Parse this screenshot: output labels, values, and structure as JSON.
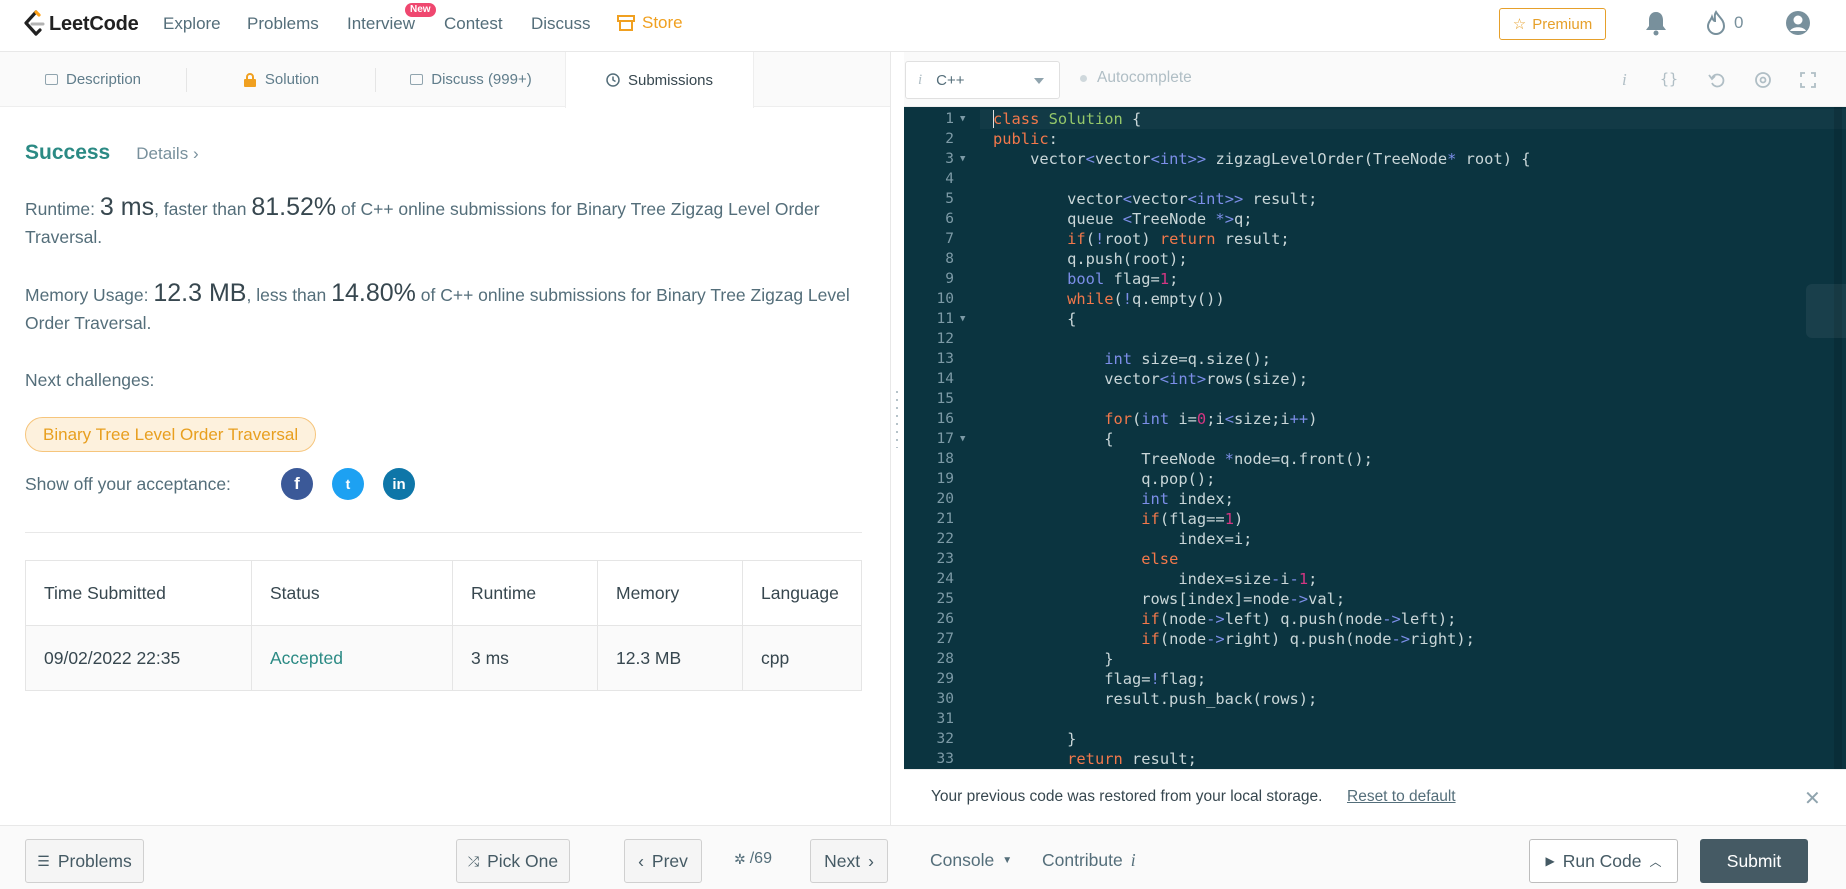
{
  "nav": {
    "logo_text": "LeetCode",
    "links": [
      "Explore",
      "Problems",
      "Interview",
      "Contest",
      "Discuss"
    ],
    "new_badge": "New",
    "store": "Store",
    "premium": "Premium",
    "streak_count": "0",
    "brand_color": "#f0a020"
  },
  "tabs": {
    "description": "Description",
    "solution": "Solution",
    "discuss": "Discuss (999+)",
    "submissions": "Submissions"
  },
  "result": {
    "status": "Success",
    "details": "Details",
    "runtime_label": "Runtime: ",
    "runtime_value": "3 ms",
    "runtime_mid": ", faster than ",
    "runtime_pct": "81.52%",
    "runtime_tail": " of C++ online submissions for Binary Tree Zigzag Level Order Traversal.",
    "memory_label": "Memory Usage: ",
    "memory_value": "12.3 MB",
    "memory_mid": ", less than ",
    "memory_pct": "14.80%",
    "memory_tail": " of C++ online submissions for Binary Tree Zigzag Level Order Traversal.",
    "next_challenges": "Next challenges:",
    "challenge": "Binary Tree Level Order Traversal",
    "show_off": "Show off your acceptance:",
    "social": [
      "f",
      "t",
      "in"
    ]
  },
  "table": {
    "headers": [
      "Time Submitted",
      "Status",
      "Runtime",
      "Memory",
      "Language"
    ],
    "rows": [
      [
        "09/02/2022 22:35",
        "Accepted",
        "3 ms",
        "12.3 MB",
        "cpp"
      ]
    ]
  },
  "editor": {
    "language": "C++",
    "autocomplete": "Autocomplete",
    "lines": [
      [
        [
          "kw",
          "class"
        ],
        [
          "",
          " "
        ],
        [
          "cls",
          "Solution"
        ],
        [
          "",
          " {"
        ]
      ],
      [
        [
          "kw",
          "public"
        ],
        [
          "",
          ":"
        ]
      ],
      [
        [
          "",
          "    vector"
        ],
        [
          "ty",
          "<"
        ],
        [
          "",
          "vector"
        ],
        [
          "ty",
          "<int>>"
        ],
        [
          "",
          " zigzagLevelOrder(TreeNode"
        ],
        [
          "ty",
          "*"
        ],
        [
          "",
          " root) {"
        ]
      ],
      [
        [
          "",
          ""
        ]
      ],
      [
        [
          "",
          "        vector"
        ],
        [
          "ty",
          "<"
        ],
        [
          "",
          "vector"
        ],
        [
          "ty",
          "<int>>"
        ],
        [
          "",
          " result;"
        ]
      ],
      [
        [
          "",
          "        queue "
        ],
        [
          "ty",
          "<"
        ],
        [
          "",
          "TreeNode "
        ],
        [
          "ty",
          "*>"
        ],
        [
          "",
          "q;"
        ]
      ],
      [
        [
          "",
          "        "
        ],
        [
          "kw",
          "if"
        ],
        [
          "",
          "("
        ],
        [
          "ty",
          "!"
        ],
        [
          "",
          "root) "
        ],
        [
          "kw",
          "return"
        ],
        [
          "",
          " result;"
        ]
      ],
      [
        [
          "",
          "        q.push(root);"
        ]
      ],
      [
        [
          "",
          "        "
        ],
        [
          "ty",
          "bool"
        ],
        [
          "",
          " flag="
        ],
        [
          "nm",
          "1"
        ],
        [
          "",
          ";"
        ]
      ],
      [
        [
          "",
          "        "
        ],
        [
          "kw",
          "while"
        ],
        [
          "",
          "("
        ],
        [
          "ty",
          "!"
        ],
        [
          "",
          "q.empty())"
        ]
      ],
      [
        [
          "",
          "        {"
        ]
      ],
      [
        [
          "",
          ""
        ]
      ],
      [
        [
          "",
          "            "
        ],
        [
          "ty",
          "int"
        ],
        [
          "",
          " size=q.size();"
        ]
      ],
      [
        [
          "",
          "            vector"
        ],
        [
          "ty",
          "<int>"
        ],
        [
          "",
          "rows(size);"
        ]
      ],
      [
        [
          "",
          ""
        ]
      ],
      [
        [
          "",
          "            "
        ],
        [
          "kw",
          "for"
        ],
        [
          "",
          "("
        ],
        [
          "ty",
          "int"
        ],
        [
          "",
          " i="
        ],
        [
          "nm",
          "0"
        ],
        [
          "",
          ";i"
        ],
        [
          "ty",
          "<"
        ],
        [
          "",
          "size;i"
        ],
        [
          "ty",
          "++"
        ],
        [
          "",
          ")"
        ]
      ],
      [
        [
          "",
          "            {"
        ]
      ],
      [
        [
          "",
          "                TreeNode "
        ],
        [
          "ty",
          "*"
        ],
        [
          "",
          "node=q.front();"
        ]
      ],
      [
        [
          "",
          "                q.pop();"
        ]
      ],
      [
        [
          "",
          "                "
        ],
        [
          "ty",
          "int"
        ],
        [
          "",
          " index;"
        ]
      ],
      [
        [
          "",
          "                "
        ],
        [
          "kw",
          "if"
        ],
        [
          "",
          "(flag=="
        ],
        [
          "nm",
          "1"
        ],
        [
          "",
          ")"
        ]
      ],
      [
        [
          "",
          "                    index=i;"
        ]
      ],
      [
        [
          "",
          "                "
        ],
        [
          "kw",
          "else"
        ]
      ],
      [
        [
          "",
          "                    index=size"
        ],
        [
          "ty",
          "-"
        ],
        [
          "",
          "i"
        ],
        [
          "ty",
          "-"
        ],
        [
          "nm",
          "1"
        ],
        [
          "",
          ";"
        ]
      ],
      [
        [
          "",
          "                rows[index]=node"
        ],
        [
          "ty",
          "->"
        ],
        [
          "",
          "val;"
        ]
      ],
      [
        [
          "",
          "                "
        ],
        [
          "kw",
          "if"
        ],
        [
          "",
          "(node"
        ],
        [
          "ty",
          "->"
        ],
        [
          "",
          "left) q.push(node"
        ],
        [
          "ty",
          "->"
        ],
        [
          "",
          "left);"
        ]
      ],
      [
        [
          "",
          "                "
        ],
        [
          "kw",
          "if"
        ],
        [
          "",
          "(node"
        ],
        [
          "ty",
          "->"
        ],
        [
          "",
          "right) q.push(node"
        ],
        [
          "ty",
          "->"
        ],
        [
          "",
          "right);"
        ]
      ],
      [
        [
          "",
          "            }"
        ]
      ],
      [
        [
          "",
          "            flag="
        ],
        [
          "ty",
          "!"
        ],
        [
          "",
          "flag;"
        ]
      ],
      [
        [
          "",
          "            result.push_back(rows);"
        ]
      ],
      [
        [
          "",
          ""
        ]
      ],
      [
        [
          "",
          "        }"
        ]
      ],
      [
        [
          "",
          "        "
        ],
        [
          "kw",
          "return"
        ],
        [
          "",
          " result;"
        ]
      ]
    ],
    "fold_lines": [
      1,
      3,
      11,
      17
    ]
  },
  "notice": {
    "text": "Your previous code was restored from your local storage.",
    "link": "Reset to default"
  },
  "bottom": {
    "problems": "Problems",
    "pick_one": "Pick One",
    "prev": "Prev",
    "page": "/69",
    "next": "Next",
    "console": "Console",
    "contribute": "Contribute",
    "run_code": "Run Code",
    "submit": "Submit"
  }
}
